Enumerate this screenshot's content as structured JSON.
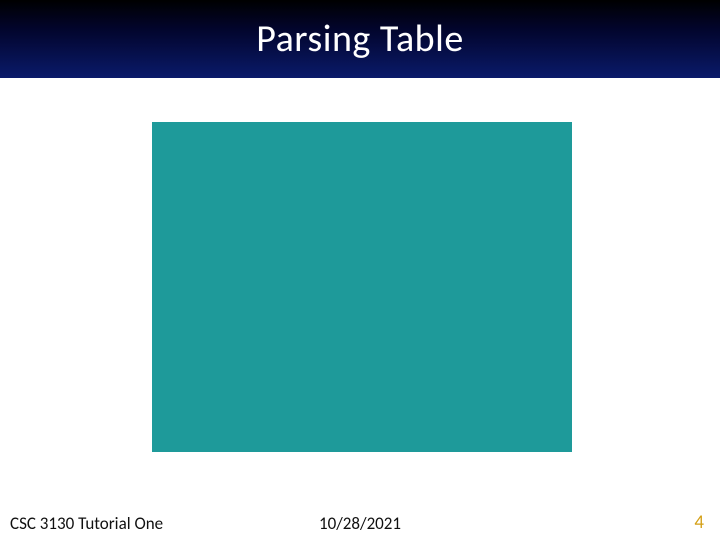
{
  "slide": {
    "title": "Parsing Table",
    "footer_left": "CSC 3130 Tutorial One",
    "footer_center": "10/28/2021",
    "page_number": "4"
  },
  "colors": {
    "title_band_gradient_start": "#000000",
    "title_band_gradient_end": "#0a1a6a",
    "title_text": "#ffffff",
    "placeholder_fill": "#1e9a9a",
    "page_number": "#d4a017"
  }
}
